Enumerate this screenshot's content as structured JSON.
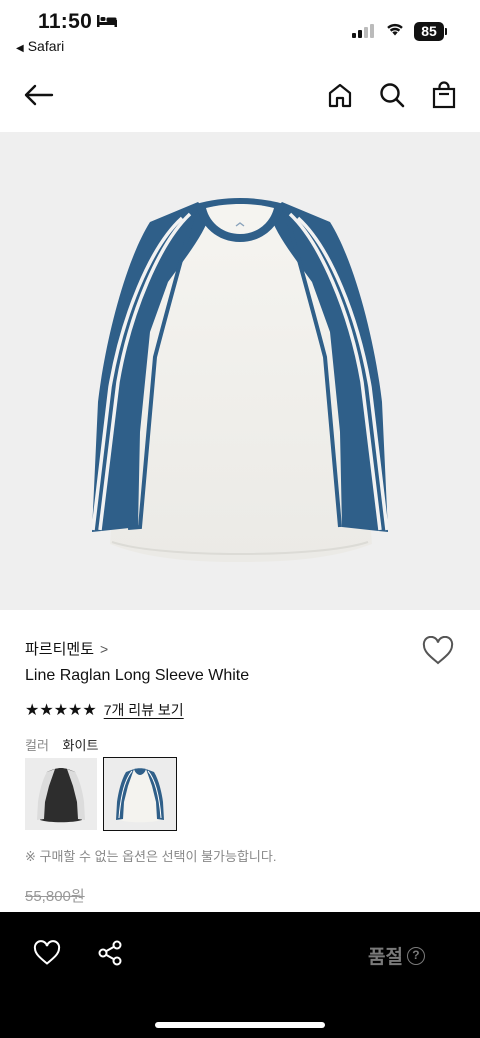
{
  "status": {
    "time": "11:50",
    "back_app": "Safari",
    "battery": "85"
  },
  "nav": {
    "icons": [
      "back-arrow-icon",
      "home-icon",
      "search-icon",
      "shopping-bag-icon"
    ]
  },
  "product": {
    "brand": "파르티멘토",
    "brand_chevron": ">",
    "name": "Line Raglan Long Sleeve White",
    "stars": "★★★★★",
    "rating": 5,
    "review_link": "7개 리뷰 보기",
    "color_label": "컬러",
    "color_value": "화이트",
    "swatches": [
      {
        "name": "charcoal",
        "body": "#2d2d2d",
        "sleeve": "#dcdcdc",
        "selected": false
      },
      {
        "name": "white",
        "body": "#f4f3ef",
        "sleeve": "#2f5f89",
        "selected": true
      }
    ],
    "note": "※ 구매할 수 없는 옵션은 선택이 불가능합니다.",
    "price": "55,800원"
  },
  "bottom_bar": {
    "status_label": "품절",
    "help_icon": "?"
  },
  "colors": {
    "background": "#efefef",
    "sleeve": "#2f5f89",
    "body": "#f4f3ef",
    "bar": "#000000",
    "muted": "#888888"
  }
}
